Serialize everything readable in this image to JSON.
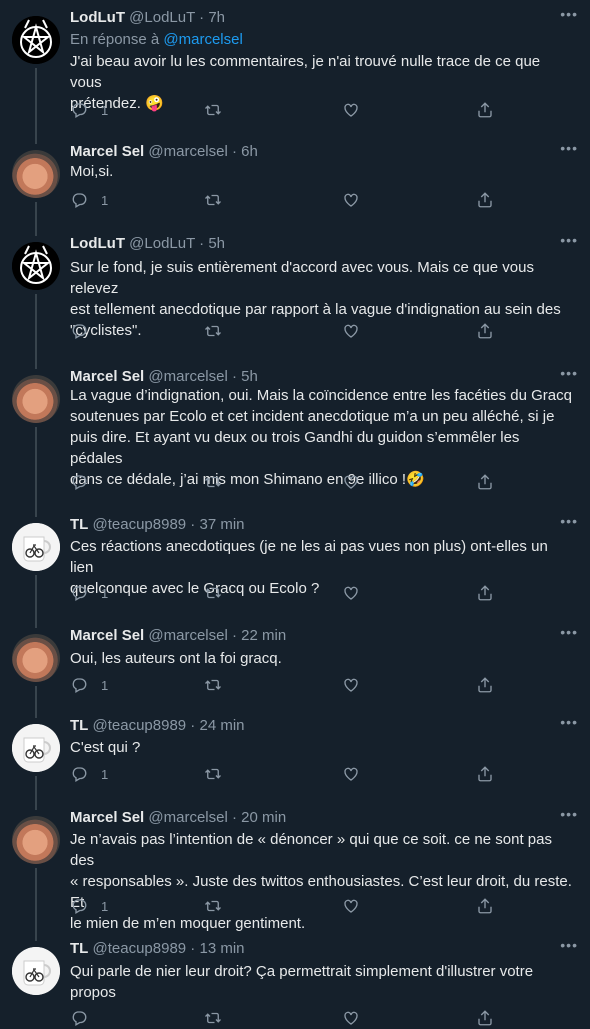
{
  "tweets": [
    {
      "author": "LodLuT",
      "handle": "@LodLuT",
      "time": "7h",
      "avatar": "lodlut",
      "reply_prefix": "En réponse à",
      "reply_mention": "@marcelsel",
      "lines": [
        "J'ai beau avoir lu les commentaires, je n'ai trouvé nulle trace de ce que vous",
        "prétendez. 🤪"
      ],
      "replies": "1"
    },
    {
      "author": "Marcel Sel",
      "handle": "@marcelsel",
      "time": "6h",
      "avatar": "marcel",
      "lines": [
        "Moi,si."
      ],
      "replies": "1"
    },
    {
      "author": "LodLuT",
      "handle": "@LodLuT",
      "time": "5h",
      "avatar": "lodlut",
      "lines": [
        "Sur le fond, je suis entièrement d'accord avec vous. Mais ce que vous relevez",
        "est tellement anecdotique par rapport à la vague d'indignation au sein des",
        "\"cyclistes\"."
      ],
      "replies": ""
    },
    {
      "author": "Marcel Sel",
      "handle": "@marcelsel",
      "time": "5h",
      "avatar": "marcel",
      "lines": [
        "La vague d’indignation, oui. Mais la coïncidence entre les facéties du Gracq",
        "soutenues par Ecolo et cet incident anecdotique m’a un peu alléché, si je",
        "puis dire. Et ayant vu deux ou trois Gandhi du guidon s’emmêler les pédales",
        "dans ce dédale, j’ai mis mon Shimano en 9e illico !🤣"
      ],
      "replies": ""
    },
    {
      "author": "TL",
      "handle": "@teacup8989",
      "time": "37 min",
      "avatar": "tl",
      "lines": [
        "Ces réactions anecdotiques (je ne les ai pas vues non plus) ont-elles un lien",
        "quelconque avec le Gracq ou Ecolo ?"
      ],
      "replies": "1"
    },
    {
      "author": "Marcel Sel",
      "handle": "@marcelsel",
      "time": "22 min",
      "avatar": "marcel",
      "lines": [
        "Oui, les auteurs ont la foi gracq."
      ],
      "replies": "1"
    },
    {
      "author": "TL",
      "handle": "@teacup8989",
      "time": "24 min",
      "avatar": "tl",
      "lines": [
        "C'est qui ?"
      ],
      "replies": "1"
    },
    {
      "author": "Marcel Sel",
      "handle": "@marcelsel",
      "time": "20 min",
      "avatar": "marcel",
      "lines": [
        "Je n’avais pas l’intention de « dénoncer » qui que ce soit. ce ne sont pas des",
        "« responsables ». Juste des twittos enthousiastes. C’est leur droit, du reste. Et",
        "le mien de m’en moquer gentiment."
      ],
      "replies": "1"
    },
    {
      "author": "TL",
      "handle": "@teacup8989",
      "time": "13 min",
      "avatar": "tl",
      "lines": [
        "Qui parle de nier leur droit? Ça permettrait simplement d'illustrer votre",
        "propos"
      ],
      "replies": ""
    }
  ],
  "separator": "·",
  "more_label": "•••"
}
